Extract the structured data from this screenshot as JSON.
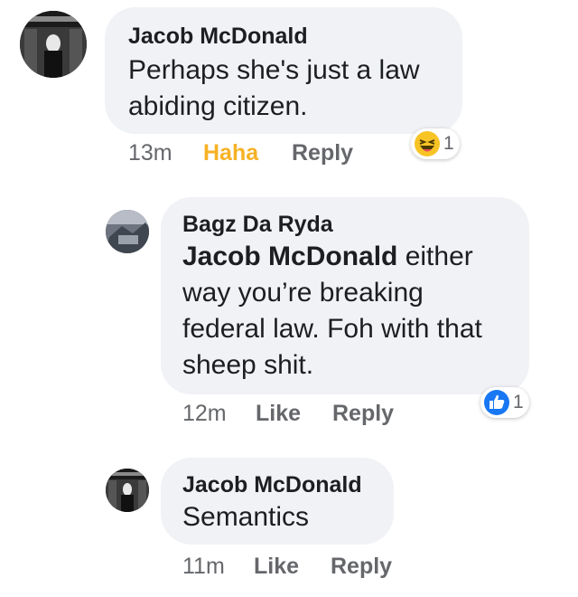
{
  "comments": [
    {
      "author": "Jacob McDonald",
      "text_lines": [
        "Perhaps she's just a law",
        "abiding citizen."
      ],
      "time": "13m",
      "reaction_label": "Haha",
      "reply_label": "Reply",
      "reaction_icon": "haha-emoji-icon",
      "reaction_count": "1"
    },
    {
      "author": "Bagz Da Ryda",
      "mention": "Jacob McDonald",
      "text_first_line_rest": " either",
      "text_lines": [
        "way you’re breaking",
        "federal law. Foh with that",
        "sheep shit."
      ],
      "time": "12m",
      "like_label": "Like",
      "reply_label": "Reply",
      "reaction_icon": "like-thumb-icon",
      "reaction_count": "1"
    },
    {
      "author": "Jacob McDonald",
      "text": "Semantics",
      "time": "11m",
      "like_label": "Like",
      "reply_label": "Reply"
    }
  ],
  "colors": {
    "bubble": "#f0f2f5",
    "meta": "#65676b",
    "haha": "#f7b125",
    "like_blue": "#1877f2"
  }
}
